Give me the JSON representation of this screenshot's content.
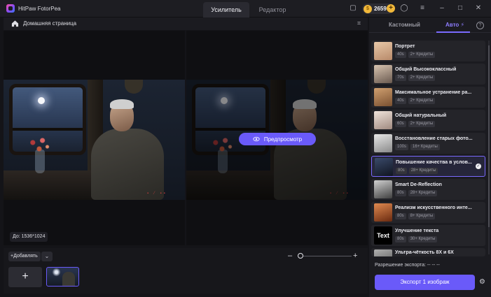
{
  "app": {
    "title": "HitPaw FotorPea"
  },
  "mode_tabs": [
    {
      "label": "Усилитель"
    },
    {
      "label": "Редактор"
    }
  ],
  "credits": {
    "value": "2659"
  },
  "home": {
    "label": "Домашняя страница"
  },
  "preview": {
    "label": "Предпросмотр"
  },
  "image": {
    "size_label": "До: 1536*1024"
  },
  "bottom": {
    "add_label": "Добавлять"
  },
  "side": {
    "tab_custom": "Кастомный",
    "tab_auto": "Авто",
    "models": [
      {
        "name": "Портрет",
        "time": "40s",
        "credits": "2+ Кредиты"
      },
      {
        "name": "Общий Высококлассный",
        "time": "70s",
        "credits": "2+ Кредиты"
      },
      {
        "name": "Максимальное устранение ра...",
        "time": "40s",
        "credits": "2+ Кредиты"
      },
      {
        "name": "Общий натуральный",
        "time": "60s",
        "credits": "2+ Кредиты"
      },
      {
        "name": "Восстановление старых фото...",
        "time": "100s",
        "credits": "16+ Кредиты"
      },
      {
        "name": "Повышение качества в услов...",
        "time": "80s",
        "credits": "28+ Кредиты"
      },
      {
        "name": "Smart De-Reflection",
        "time": "80s",
        "credits": "28+ Кредиты"
      },
      {
        "name": "Реализм искусственного инте...",
        "time": "80s",
        "credits": "8+ Кредиты"
      },
      {
        "name": "Улучшение текста",
        "time": "80s",
        "credits": "30+ Кредиты"
      },
      {
        "name": "Ультра-чёткость 8X и 6X",
        "time": "",
        "credits": ""
      }
    ],
    "export_resolution": "Разрешение экспорта: -- -- --",
    "export_button": "Экспорт 1 изображ"
  }
}
